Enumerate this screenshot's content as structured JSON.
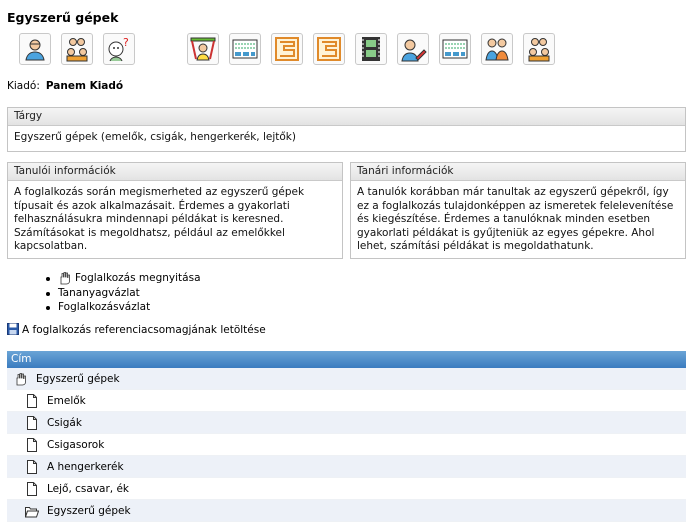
{
  "page": {
    "title": "Egyszerű gépek"
  },
  "toolbar": {
    "icons": [
      "student-profile-icon",
      "group-icon",
      "help-person-icon",
      "presentation-icon",
      "worksheet-icon",
      "maze-icon",
      "maze-icon",
      "film-icon",
      "writing-icon",
      "worksheet-icon",
      "pair-icon",
      "group-icon"
    ]
  },
  "publisher": {
    "label": "Kiadó:",
    "value": "Panem Kiadó"
  },
  "subject": {
    "heading": "Tárgy",
    "text": "Egyszerű gépek (emelők, csigák, hengerkerék, lejtők)"
  },
  "student_info": {
    "heading": "Tanulói információk",
    "text": "A foglalkozás során megismerheted az egyszerű gépek típusait és azok alkalmazásait. Érdemes a gyakorlati felhasználásukra mindennapi példákat is keresned. Számításokat is megoldhatsz, például az emelőkkel kapcsolatban."
  },
  "teacher_info": {
    "heading": "Tanári információk",
    "text": "A tanulók korábban már tanultak az egyszerű gépekről, így ez a foglalkozás tulajdonképpen az ismeretek felelevenítése és kiegészítése. Érdemes a tanulóknak minden esetben gyakorlati példákat is gyűjteniük az egyes gépekre. Ahol lehet, számítási példákat is megoldathatunk."
  },
  "links": {
    "open_lesson": "Foglalkozás megnyitása",
    "outline": "Tananyagvázlat",
    "lesson_outline": "Foglalkozásvázlat"
  },
  "download": {
    "label": "A foglalkozás referenciacsomagjának letöltése"
  },
  "tree": {
    "header": "Cím",
    "root": "Egyszerű gépek",
    "items": [
      "Emelők",
      "Csigák",
      "Csigasorok",
      "A hengerkerék",
      "Lejő, csavar, ék"
    ],
    "footer": "Egyszerű gépek"
  },
  "colors": {
    "tree_header": "#3a7bbf",
    "row_alt": "#edf1f8",
    "panel_head": "#e3e3e3"
  }
}
